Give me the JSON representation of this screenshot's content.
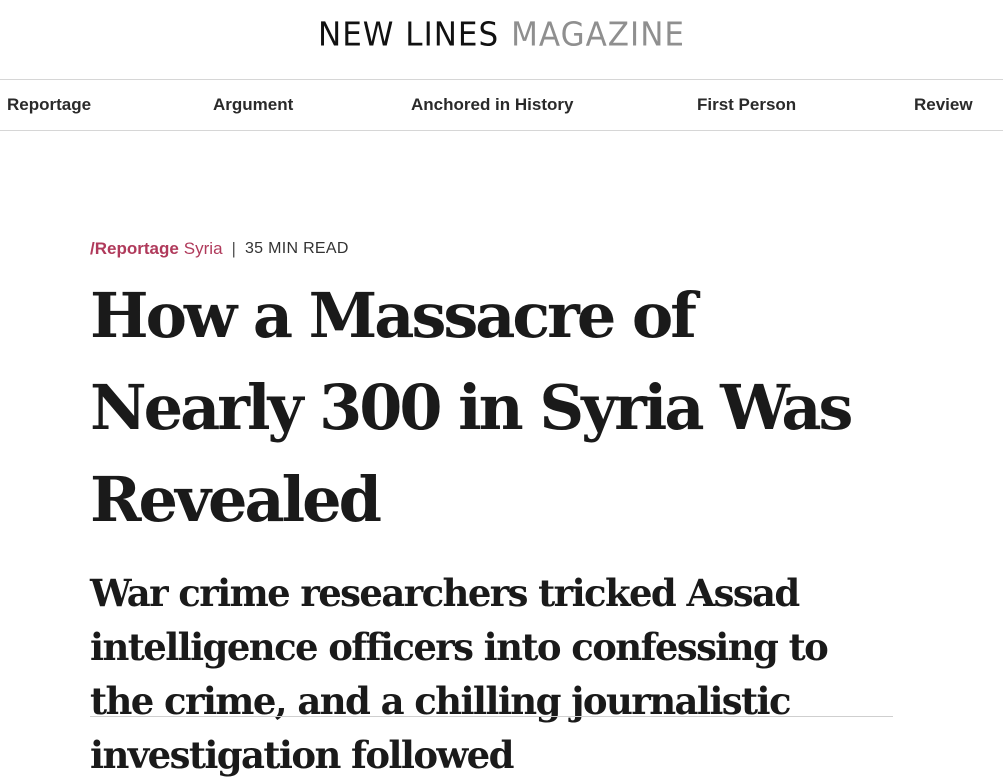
{
  "site": {
    "logo_main": "NEW LINES",
    "logo_sub": "MAGAZINE"
  },
  "nav": {
    "items": [
      {
        "label": "Reportage"
      },
      {
        "label": "Argument"
      },
      {
        "label": "Anchored in History"
      },
      {
        "label": "First Person"
      },
      {
        "label": "Review"
      }
    ]
  },
  "article": {
    "section": "/Reportage",
    "topic": "Syria",
    "separator": "|",
    "read_time": "35 MIN READ",
    "headline": "How a Massacre of Nearly 300 in Syria Was Revealed",
    "dek": "War crime researchers tricked Assad intelligence officers into confessing to the crime, and a chilling journalistic investigation followed"
  },
  "colors": {
    "accent": "#b03a5b",
    "text": "#1a1a1a",
    "logo_muted": "#8f8f8f",
    "divider": "#d6d6d6"
  }
}
